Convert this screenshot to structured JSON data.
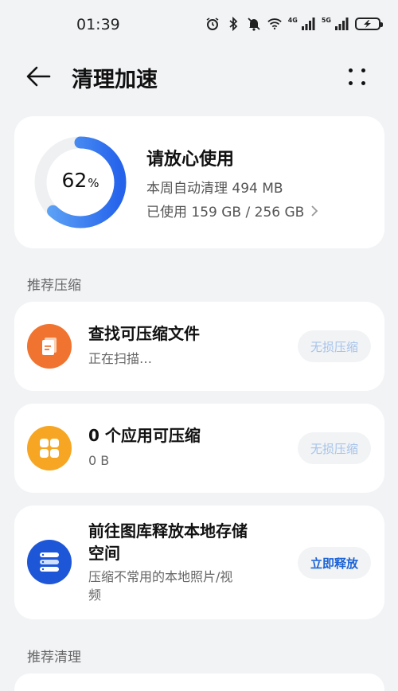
{
  "status_bar": {
    "time": "01:39",
    "signal1_label": "4G",
    "signal2_label": "5G"
  },
  "header": {
    "title": "清理加速"
  },
  "storage": {
    "percent": "62",
    "percent_sign": "%",
    "percent_value": 0.62,
    "status": "请放心使用",
    "weekly_clean": "本周自动清理 494 MB",
    "used": "已使用 159 GB / 256 GB",
    "ring_color": "#3b82f6",
    "ring_track_color": "#eef0f2"
  },
  "sections": {
    "compress_title": "推荐压缩",
    "clean_title": "推荐清理"
  },
  "items": [
    {
      "title": "查找可压缩文件",
      "subtitle": "正在扫描…",
      "button": "无损压缩",
      "icon": "document-icon",
      "icon_color": "#f07330"
    },
    {
      "title": "0 个应用可压缩",
      "subtitle": "0 B",
      "button": "无损压缩",
      "icon": "apps-grid-icon",
      "icon_color": "#f6a623"
    },
    {
      "title_line1": "前往图库释放本地存储",
      "title_line2": "空间",
      "subtitle_line1": "压缩不常用的本地照片/视",
      "subtitle_line2": "频",
      "button": "立即释放",
      "icon": "storage-stack-icon",
      "icon_color": "#1d57d8"
    }
  ],
  "colors": {
    "accent": "#1b63d6",
    "background": "#f1f3f5",
    "disabled_button_text": "#a6c3ea"
  }
}
